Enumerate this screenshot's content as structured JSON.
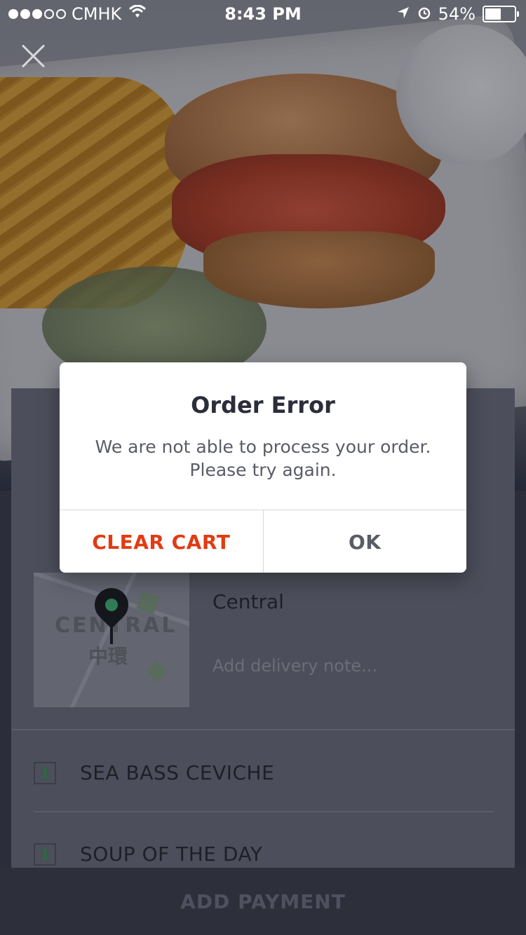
{
  "status_bar": {
    "carrier": "CMHK",
    "time": "8:43 PM",
    "battery": "54%",
    "battery_level": 0.54,
    "signal_dots_filled": 3,
    "signal_dots_total": 5
  },
  "hero": {
    "close_icon": "close-icon"
  },
  "delivery": {
    "place": "Central",
    "note_placeholder": "Add delivery note...",
    "map_label_en": "CENTRAL",
    "map_label_zh": "中環"
  },
  "cart": {
    "items": [
      {
        "qty": "1",
        "name": "SEA BASS CEVICHE"
      },
      {
        "qty": "1",
        "name": "SOUP OF THE DAY"
      }
    ]
  },
  "footer": {
    "cta_label": "ADD PAYMENT"
  },
  "dialog": {
    "title": "Order Error",
    "message_line1": "We are not able to process your order.",
    "message_line2": "Please try again.",
    "clear_label": "CLEAR CART",
    "ok_label": "OK"
  },
  "colors": {
    "danger": "#e23b13",
    "status_green": "#2e7d53"
  }
}
